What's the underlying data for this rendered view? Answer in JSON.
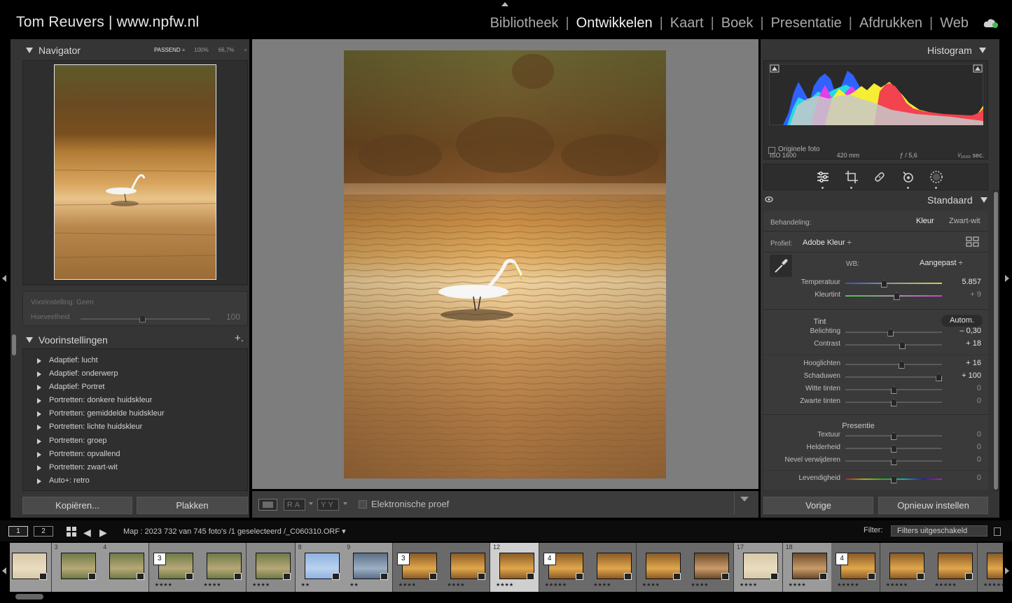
{
  "identity": "Tom Reuvers | www.npfw.nl",
  "modules": [
    "Bibliotheek",
    "Ontwikkelen",
    "Kaart",
    "Boek",
    "Presentatie",
    "Afdrukken",
    "Web"
  ],
  "active_module": "Ontwikkelen",
  "navigator": {
    "title": "Navigator",
    "zoom_fit": "PASSEND ÷",
    "zoom_100": "100%",
    "zoom_custom": "66,7%",
    "zoom_stepper": "÷"
  },
  "preset_amount": {
    "preset": "Voorinstelling: Geen",
    "amount_label": "Hoeveelheid",
    "amount_value": "100"
  },
  "presets": {
    "title": "Voorinstellingen",
    "add": "+.",
    "items": [
      "Adaptief: lucht",
      "Adaptief: onderwerp",
      "Adaptief: Portret",
      "Portretten: donkere huidskleur",
      "Portretten: gemiddelde huidskleur",
      "Portretten: lichte huidskleur",
      "Portretten: groep",
      "Portretten: opvallend",
      "Portretten: zwart-wit",
      "Auto+: retro"
    ]
  },
  "left_buttons": {
    "copy": "Kopiëren...",
    "paste": "Plakken"
  },
  "center_toolbar": {
    "ab_label": "RA",
    "yy_label": "YY",
    "soft_proof": "Elektronische proef"
  },
  "histogram": {
    "title": "Histogram",
    "iso": "ISO 1600",
    "focal": "420 mm",
    "aperture": "ƒ / 5,6",
    "shutter": "¹⁄₁₆₀₀ sec.",
    "original_photo": "Originele foto"
  },
  "develop": {
    "profile_section": "Standaard",
    "treatment_label": "Behandeling:",
    "treatment_color": "Kleur",
    "treatment_bw": "Zwart-wit",
    "profile_label": "Profiel:",
    "profile_value": "Adobe Kleur ÷",
    "wb_label": "WB:",
    "wb_value": "Aangepast ÷",
    "tone_title": "Tint",
    "auto_label": "Autom.",
    "presence_title": "Presentie",
    "sliders": [
      {
        "label": "Temperatuur",
        "value": "5.857",
        "pos": 0.4,
        "group": "wb"
      },
      {
        "label": "Kleurtint",
        "value": "+ 9",
        "pos": 0.53,
        "group": "wb",
        "dim": true
      },
      {
        "label": "Belichting",
        "value": "– 0,30",
        "pos": 0.47,
        "group": "tone"
      },
      {
        "label": "Contrast",
        "value": "+ 18",
        "pos": 0.59,
        "group": "tone"
      },
      {
        "label": "Hooglichten",
        "value": "+ 16",
        "pos": 0.58,
        "group": "tone2"
      },
      {
        "label": "Schaduwen",
        "value": "+ 100",
        "pos": 0.97,
        "group": "tone2"
      },
      {
        "label": "Witte tinten",
        "value": "0",
        "pos": 0.5,
        "group": "tone2",
        "dim": true
      },
      {
        "label": "Zwarte tinten",
        "value": "0",
        "pos": 0.5,
        "group": "tone2",
        "dim": true
      },
      {
        "label": "Textuur",
        "value": "0",
        "pos": 0.5,
        "group": "presence",
        "dim": true
      },
      {
        "label": "Helderheid",
        "value": "0",
        "pos": 0.5,
        "group": "presence",
        "dim": true
      },
      {
        "label": "Nevel verwijderen",
        "value": "0",
        "pos": 0.5,
        "group": "presence",
        "dim": true
      },
      {
        "label": "Levendigheid",
        "value": "0",
        "pos": 0.5,
        "group": "presence2",
        "dim": true
      }
    ]
  },
  "right_buttons": {
    "previous": "Vorige",
    "reset": "Opnieuw instellen"
  },
  "film_bar": {
    "monitor1": "1",
    "monitor2": "2",
    "path": "Map : 2023      732 van 745 foto's /1 geselecteerd /_C060310.ORF ▾",
    "filter_label": "Filter:",
    "filter_value": "Filters uitgeschakeld"
  },
  "filmstrip": [
    {
      "num": "",
      "stars": "",
      "stack": "",
      "tone": "pale"
    },
    {
      "num": "3",
      "stars": "",
      "stack": "",
      "tone": "green"
    },
    {
      "num": "4",
      "stars": "",
      "stack": "",
      "tone": "green"
    },
    {
      "num": "",
      "stars": "★★★★",
      "stack": "3",
      "tone": "green"
    },
    {
      "num": "",
      "stars": "★★★★",
      "stack": "",
      "tone": "green"
    },
    {
      "num": "",
      "stars": "★★★★",
      "stack": "",
      "tone": "green"
    },
    {
      "num": "8",
      "stars": "★★",
      "stack": "",
      "tone": "blue"
    },
    {
      "num": "9",
      "stars": "★★",
      "stack": "",
      "tone": "water"
    },
    {
      "num": "",
      "stars": "★★★★",
      "stack": "3",
      "tone": "gold"
    },
    {
      "num": "",
      "stars": "★★★★",
      "stack": "",
      "tone": "gold"
    },
    {
      "num": "12",
      "stars": "★★★★",
      "stack": "",
      "tone": "gold"
    },
    {
      "num": "",
      "stars": "★★★★★",
      "stack": "4",
      "tone": "gold"
    },
    {
      "num": "",
      "stars": "★★★★",
      "stack": "",
      "tone": "gold"
    },
    {
      "num": "",
      "stars": "★★★★",
      "stack": "",
      "tone": "gold"
    },
    {
      "num": "",
      "stars": "★★★★",
      "stack": "",
      "tone": "dusk"
    },
    {
      "num": "17",
      "stars": "★★★★",
      "stack": "",
      "tone": "pale"
    },
    {
      "num": "18",
      "stars": "★★★★",
      "stack": "",
      "tone": "dusk"
    },
    {
      "num": "",
      "stars": "★★★★★",
      "stack": "4",
      "tone": "gold"
    },
    {
      "num": "",
      "stars": "★★★★★",
      "stack": "",
      "tone": "gold"
    },
    {
      "num": "",
      "stars": "★★★★★",
      "stack": "",
      "tone": "gold"
    },
    {
      "num": "",
      "stars": "★★★★★",
      "stack": "",
      "tone": "gold"
    }
  ],
  "colors": {
    "panel": "#353535",
    "accent_active": "#f2f2f2",
    "hist_blue": "#2f62ff",
    "hist_cyan": "#27d8e0",
    "hist_magenta": "#e23fe6",
    "hist_yellow": "#f5ee35",
    "hist_red": "#f2434f"
  }
}
